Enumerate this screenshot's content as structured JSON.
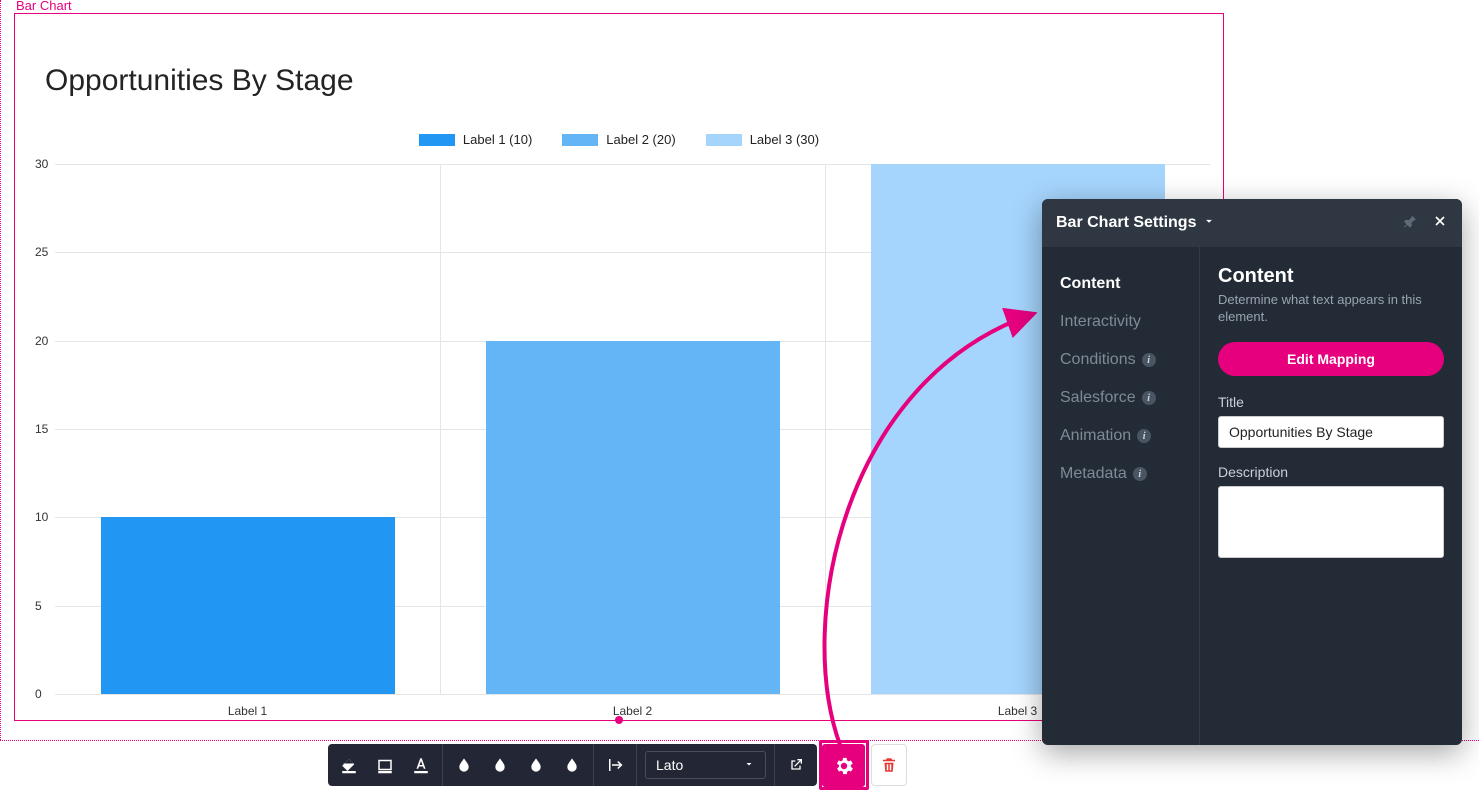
{
  "frame_label": "Bar Chart",
  "chart_data": {
    "type": "bar",
    "title": "Opportunities By Stage",
    "categories": [
      "Label 1",
      "Label 2",
      "Label 3"
    ],
    "values": [
      10,
      20,
      30
    ],
    "series_colors": [
      "#2196f3",
      "#64b5f6",
      "#a5d4fc"
    ],
    "legend": [
      "Label 1 (10)",
      "Label 2 (20)",
      "Label 3 (30)"
    ],
    "y_ticks": [
      0,
      5,
      10,
      15,
      20,
      25,
      30
    ],
    "ylim": [
      0,
      30
    ],
    "xlabel": "",
    "ylabel": ""
  },
  "toolbar": {
    "font_name": "Lato"
  },
  "panel": {
    "title": "Bar Chart Settings",
    "nav": {
      "content": "Content",
      "interactivity": "Interactivity",
      "conditions": "Conditions",
      "salesforce": "Salesforce",
      "animation": "Animation",
      "metadata": "Metadata"
    },
    "content": {
      "heading": "Content",
      "description": "Determine what text appears in this element.",
      "edit_mapping": "Edit Mapping",
      "title_label": "Title",
      "title_value": "Opportunities By Stage",
      "desc_label": "Description",
      "desc_value": ""
    }
  }
}
